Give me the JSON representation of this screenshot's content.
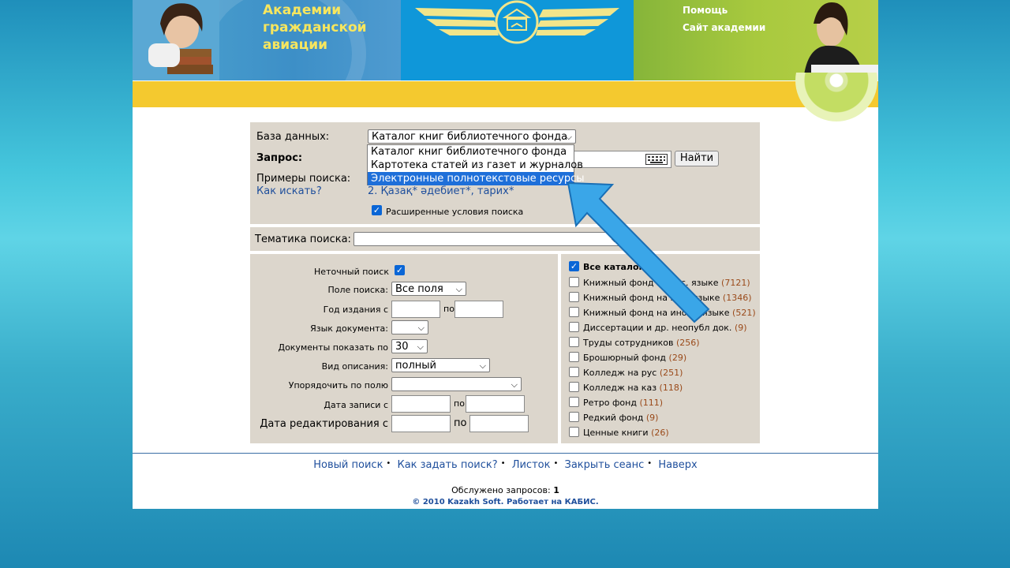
{
  "header": {
    "title_lines": [
      "Академии",
      "гражданской",
      "авиации"
    ],
    "links": [
      "Помощь",
      "Сайт академии"
    ]
  },
  "search": {
    "db_label": "База данных:",
    "db_selected": "Каталог книг библиотечного фонда",
    "db_options": [
      "Каталог книг библиотечного фонда",
      "Картотека статей из газет и журналов",
      "Электронные полнотекстовые ресурсы"
    ],
    "db_highlighted_index": 2,
    "query_label": "Запрос:",
    "find_button": "Найти",
    "examples_label": "Примеры поиска:",
    "how_link": "Как искать?",
    "example_2": "2. Қазақ* әдебиет*, тарих*",
    "extended_label": "Расширенные условия поиска",
    "extended_checked": true
  },
  "topic": {
    "label": "Тематика поиска:",
    "value": ""
  },
  "filters": {
    "fuzzy_label": "Неточный поиск",
    "fuzzy_checked": true,
    "field_label": "Поле поиска:",
    "field_value": "Все поля",
    "year_label": "Год издания с",
    "year_to": "по",
    "lang_label": "Язык документа:",
    "lang_value": "",
    "show_label": "Документы показать по",
    "show_value": "30",
    "desc_label": "Вид описания:",
    "desc_value": "полный",
    "sort_label": "Упорядочить по полю",
    "sort_value": "",
    "rec_date_label": "Дата записи с",
    "rec_date_to": "по",
    "edit_date_label": "Дата редактирования с",
    "edit_date_to": "по"
  },
  "catalogs": {
    "all_label": "Все каталоги",
    "all_checked": true,
    "items": [
      {
        "label": "Книжный фонд на рус. языке",
        "count": "(7121)"
      },
      {
        "label": "Книжный фонд на нац. языке",
        "count": "(1346)"
      },
      {
        "label": "Книжный фонд на иност. языке",
        "count": "(521)"
      },
      {
        "label": "Диссертации и др. неопубл док.",
        "count": "(9)"
      },
      {
        "label": "Труды сотрудников",
        "count": "(256)"
      },
      {
        "label": "Брошюрный фонд",
        "count": "(29)"
      },
      {
        "label": "Колледж на рус",
        "count": "(251)"
      },
      {
        "label": "Колледж на каз",
        "count": "(118)"
      },
      {
        "label": "Ретро фонд",
        "count": "(111)"
      },
      {
        "label": "Редкий фонд",
        "count": "(9)"
      },
      {
        "label": "Ценные книги",
        "count": "(26)"
      }
    ]
  },
  "footer": {
    "nav": [
      "Новый поиск",
      "Как задать поиск?",
      "Листок",
      "Закрыть сеанс",
      "Наверх"
    ],
    "served_label": "Обслужено запросов:",
    "served_count": "1",
    "copyright": "© 2010 Kazakh Soft. Работает на КАБИС."
  },
  "colors": {
    "accent_blue": "#1e6fd9",
    "panel": "#dcd6cc",
    "header_yellow": "#f4c92f",
    "arrow": "#3aa6e8"
  }
}
